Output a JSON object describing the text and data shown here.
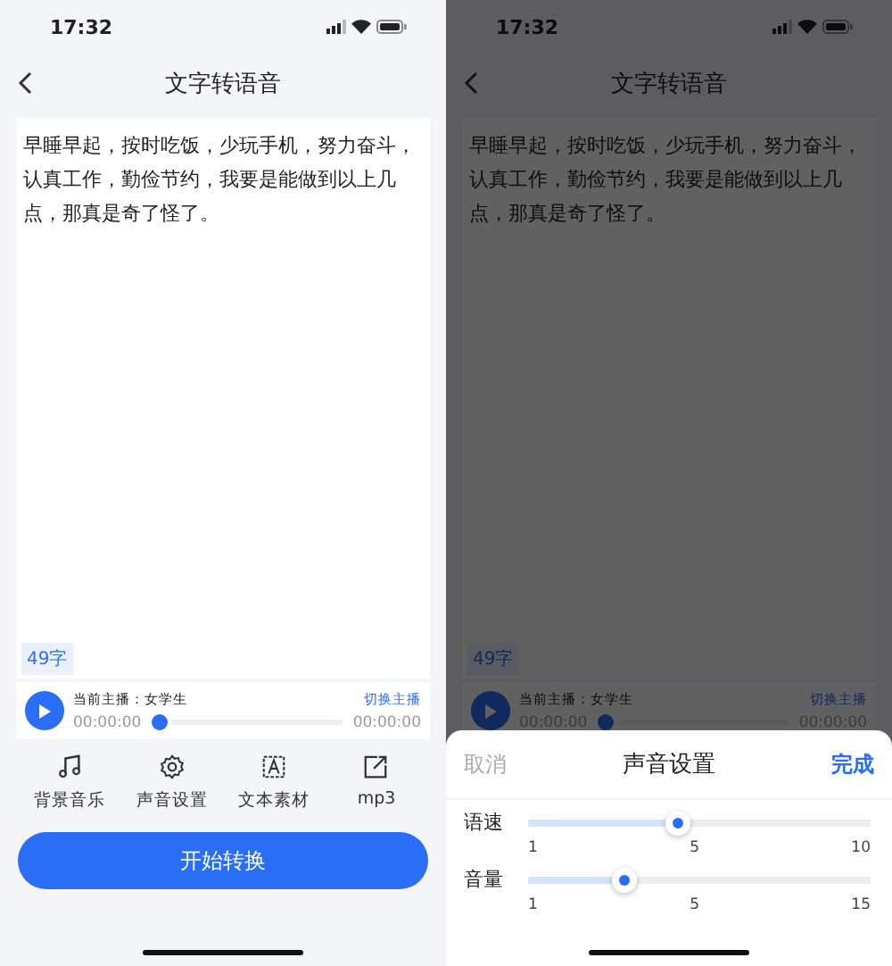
{
  "screens": [
    {
      "status_time": "17:32",
      "title": "文字转语音",
      "text": "早睡早起，按时吃饭，少玩手机，努力奋斗，认真工作，勤俭节约，我要是能做到以上几点，那真是奇了怪了。",
      "char_count": "49字",
      "player": {
        "host": "当前主播：女学生",
        "switch": "切换主播",
        "elapsed": "00:00:00",
        "total": "00:00:00",
        "level": 0
      },
      "tools": [
        {
          "kind": "music",
          "label": "背景音乐"
        },
        {
          "kind": "gear",
          "label": "声音设置"
        },
        {
          "kind": "text",
          "label": "文本素材"
        },
        {
          "kind": "export",
          "label": "mp3"
        }
      ],
      "primary_button": "开始转换"
    },
    {
      "status_time": "17:32",
      "title": "文字转语音",
      "text": "早睡早起，按时吃饭，少玩手机，努力奋斗，认真工作，勤俭节约，我要是能做到以上几点，那真是奇了怪了。",
      "char_count": "49字",
      "player": {
        "host": "当前主播：女学生",
        "switch": "切换主播",
        "elapsed": "00:00:00",
        "total": "00:00:00",
        "level": 0
      },
      "sheet": {
        "cancel": "取消",
        "title": "声音设置",
        "done": "完成",
        "sliders": [
          {
            "label": "语速",
            "level": 0.44,
            "ticks": [
              "1",
              "5",
              "10"
            ]
          },
          {
            "label": "音量",
            "level": 0.28,
            "ticks": [
              "1",
              "5",
              "15"
            ]
          }
        ]
      }
    }
  ]
}
